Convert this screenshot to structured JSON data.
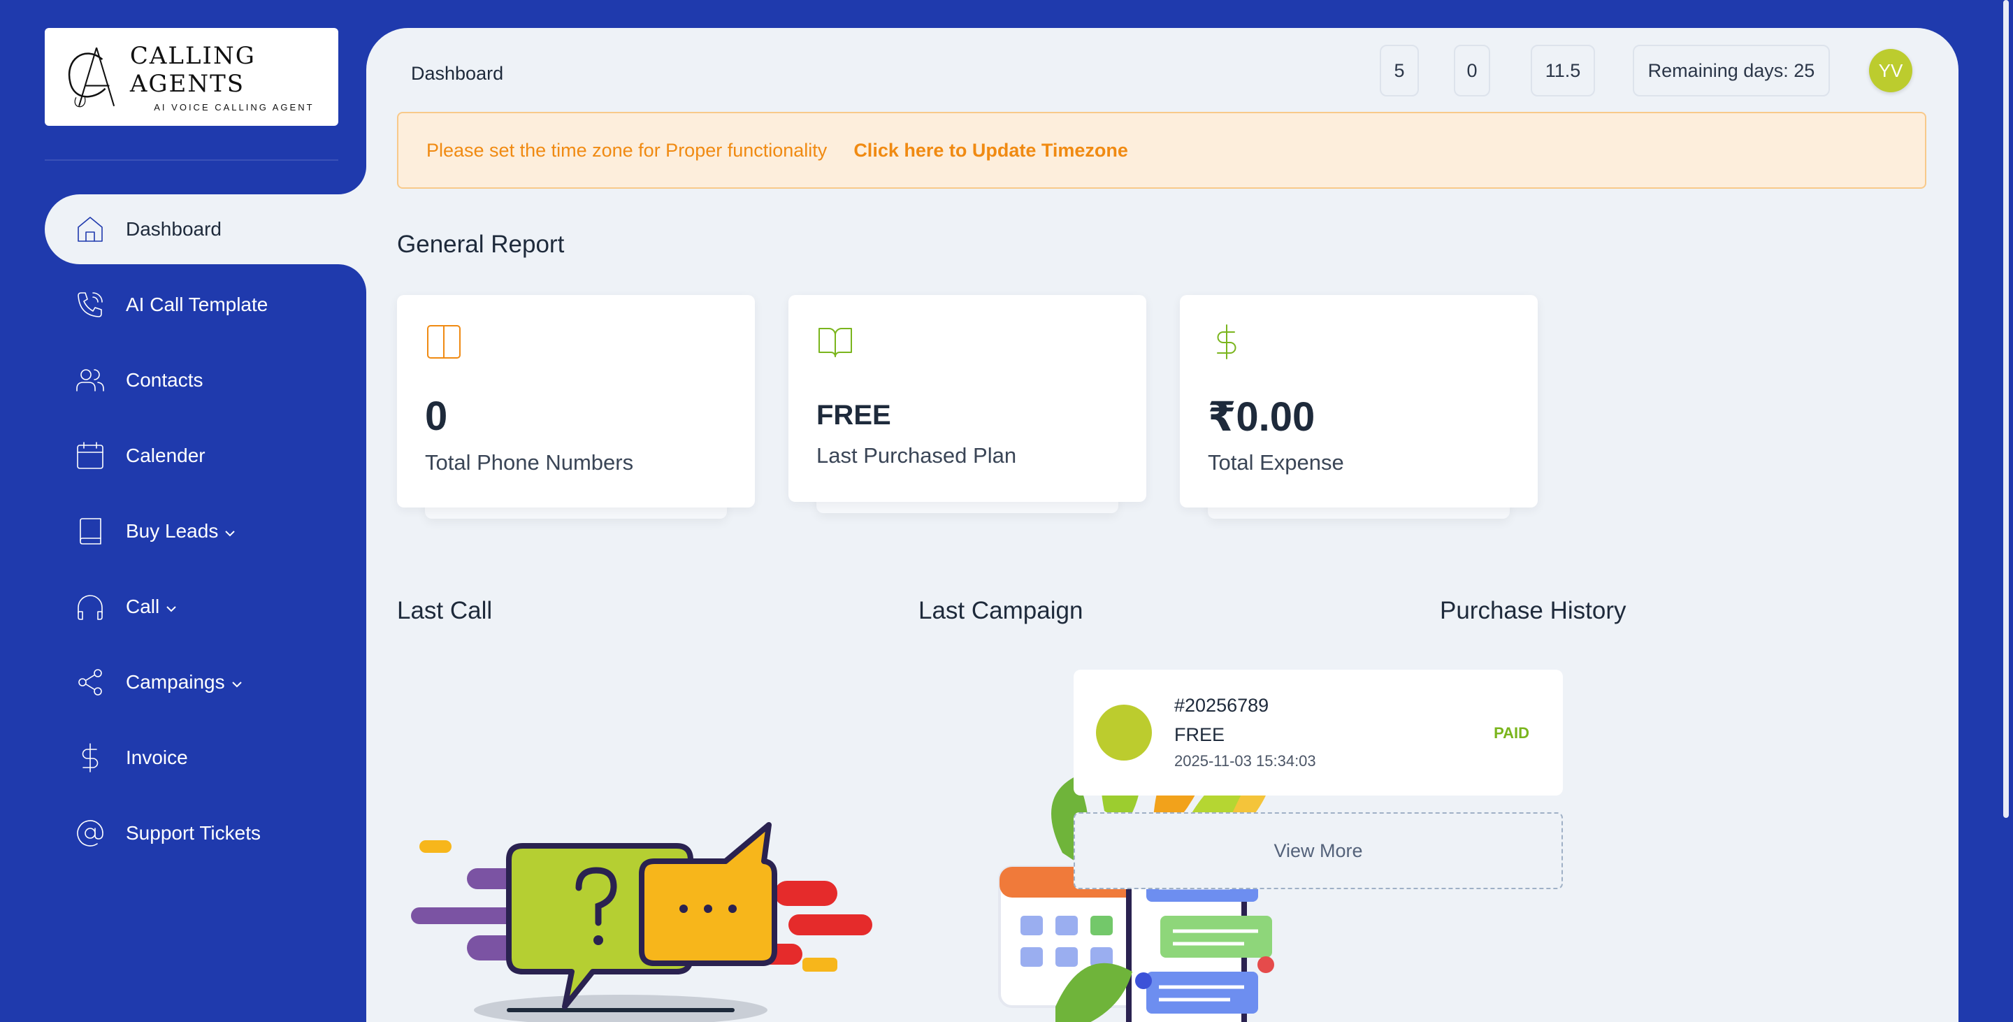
{
  "brand": {
    "logo_monogram": "CA",
    "logo_title": "CALLING AGENTS",
    "logo_subtitle": "AI VOICE CALLING AGENT"
  },
  "sidebar": {
    "items": [
      {
        "label": "Dashboard",
        "icon": "home-icon",
        "active": true
      },
      {
        "label": "AI Call Template",
        "icon": "phone-call-icon"
      },
      {
        "label": "Contacts",
        "icon": "users-icon"
      },
      {
        "label": "Calender",
        "icon": "calendar-icon"
      },
      {
        "label": "Buy Leads",
        "icon": "book-icon",
        "has_dropdown": true
      },
      {
        "label": "Call",
        "icon": "headphones-icon",
        "has_dropdown": true
      },
      {
        "label": "Campaings",
        "icon": "share-icon",
        "has_dropdown": true
      },
      {
        "label": "Invoice",
        "icon": "dollar-icon"
      },
      {
        "label": "Support Tickets",
        "icon": "at-sign-icon"
      }
    ]
  },
  "header": {
    "breadcrumb": "Dashboard",
    "stat_1": "5",
    "stat_2": "0",
    "stat_3": "11.5",
    "remaining_days": "Remaining days: 25",
    "avatar_initials": "YV"
  },
  "alert": {
    "message": "Please set the time zone for Proper functionality",
    "link": "Click here to Update Timezone"
  },
  "general_report": {
    "title": "General Report",
    "cards": [
      {
        "value": "0",
        "label": "Total Phone Numbers",
        "icon": "columns-icon",
        "color": "#f08a12"
      },
      {
        "value": "FREE",
        "label": "Last Purchased Plan",
        "icon": "book-open-icon",
        "color": "#7ab51d"
      },
      {
        "value": "₹0.00",
        "label": "Total Expense",
        "icon": "dollar-icon",
        "color": "#7ab51d"
      }
    ]
  },
  "sections": {
    "last_call": "Last Call",
    "last_campaign": "Last Campaign",
    "purchase_history": "Purchase History"
  },
  "purchase_history": {
    "items": [
      {
        "id": "#20256789",
        "plan": "FREE",
        "date": "2025-11-03 15:34:03",
        "status": "PAID"
      }
    ],
    "view_more": "View More"
  },
  "colors": {
    "sidebar_bg": "#1f3aad",
    "main_bg": "#eef2f7",
    "accent_orange": "#f08a12",
    "accent_green": "#7ab51d",
    "avatar": "#bccc2e"
  }
}
